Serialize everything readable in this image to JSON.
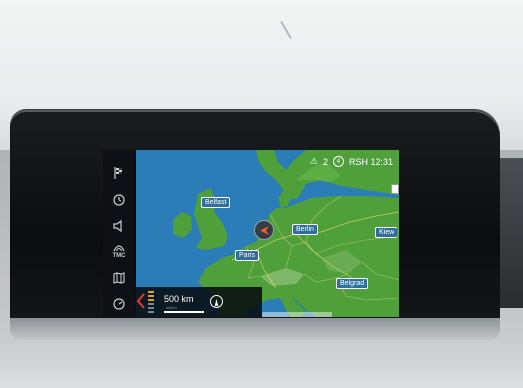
{
  "status": {
    "warning_count": "2",
    "badge_icon": "circle-badge-icon",
    "station": "RSH 12:31"
  },
  "sidebar": {
    "items": [
      {
        "name": "destination-flag-icon"
      },
      {
        "name": "clock-icon"
      },
      {
        "name": "speaker-icon"
      },
      {
        "name": "tmc-traffic-icon",
        "label": "TMC"
      },
      {
        "name": "map-book-icon"
      },
      {
        "name": "gauge-icon"
      }
    ]
  },
  "map": {
    "cities": {
      "belfast": "Belfast",
      "berlin": "Berlin",
      "paris": "Paris",
      "kiev": "Kiew",
      "belgrade": "Belgrad"
    },
    "scale": {
      "label": "500 km",
      "unit": "mi/km"
    }
  },
  "colors": {
    "sea": "#2b7db8",
    "land": "#4f9f3a",
    "label_bg": "#2f6f99",
    "bezel": "#0c0d0e"
  }
}
